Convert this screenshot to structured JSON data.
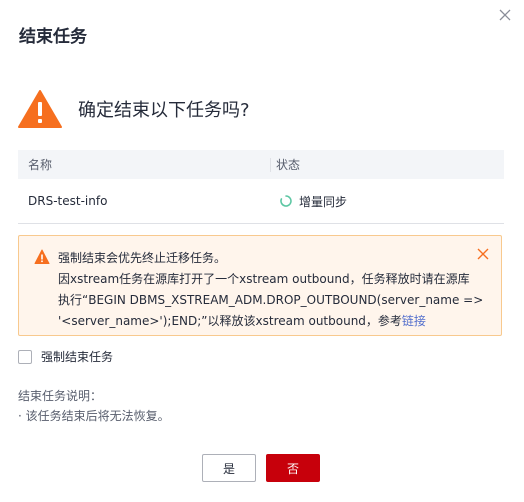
{
  "dialog": {
    "title": "结束任务",
    "confirm_text": "确定结束以下任务吗?"
  },
  "table": {
    "headers": [
      "名称",
      "状态"
    ],
    "rows": [
      {
        "name": "DRS-test-info",
        "status": "增量同步"
      }
    ]
  },
  "warning": {
    "line1": "强制结束会优先终止迁移任务。",
    "line2": "因xstream任务在源库打开了一个xstream outbound，任务释放时请在源库",
    "line3": "执行“BEGIN DBMS_XSTREAM_ADM.DROP_OUTBOUND(server_name =>",
    "line4_prefix": "'<server_name>');END;”以释放该xstream outbound，参考",
    "link": "链接"
  },
  "checkbox": {
    "label": "强制结束任务",
    "checked": false
  },
  "notes": {
    "title": "结束任务说明：",
    "items": [
      "· 该任务结束后将无法恢复。"
    ]
  },
  "buttons": {
    "yes": "是",
    "no": "否"
  },
  "colors": {
    "warning_orange": "#f66f1f",
    "status_green": "#5ec7a4",
    "primary_red": "#c7000b",
    "link_blue": "#526ecc"
  },
  "icons": [
    "close-icon",
    "warning-icon",
    "loading-icon",
    "warning-small-icon",
    "warning-close-icon"
  ]
}
